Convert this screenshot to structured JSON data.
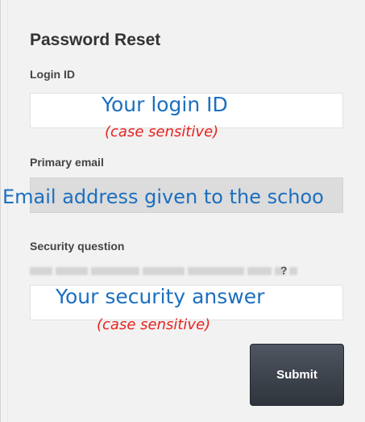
{
  "form": {
    "title": "Password Reset",
    "login_label": "Login ID",
    "email_label": "Primary email",
    "security_label": "Security question",
    "security_question_suffix": "?",
    "submit_label": "Submit"
  },
  "annotations": {
    "login_hint": "Your login ID",
    "login_note": "(case sensitive)",
    "email_hint": "Email address given to the schoo",
    "answer_hint": "Your security answer",
    "answer_note": "(case sensitive)"
  },
  "colors": {
    "annotation_blue": "#1c6fc0",
    "annotation_red": "#e8231f",
    "submit_bg": "#3a3f47"
  }
}
